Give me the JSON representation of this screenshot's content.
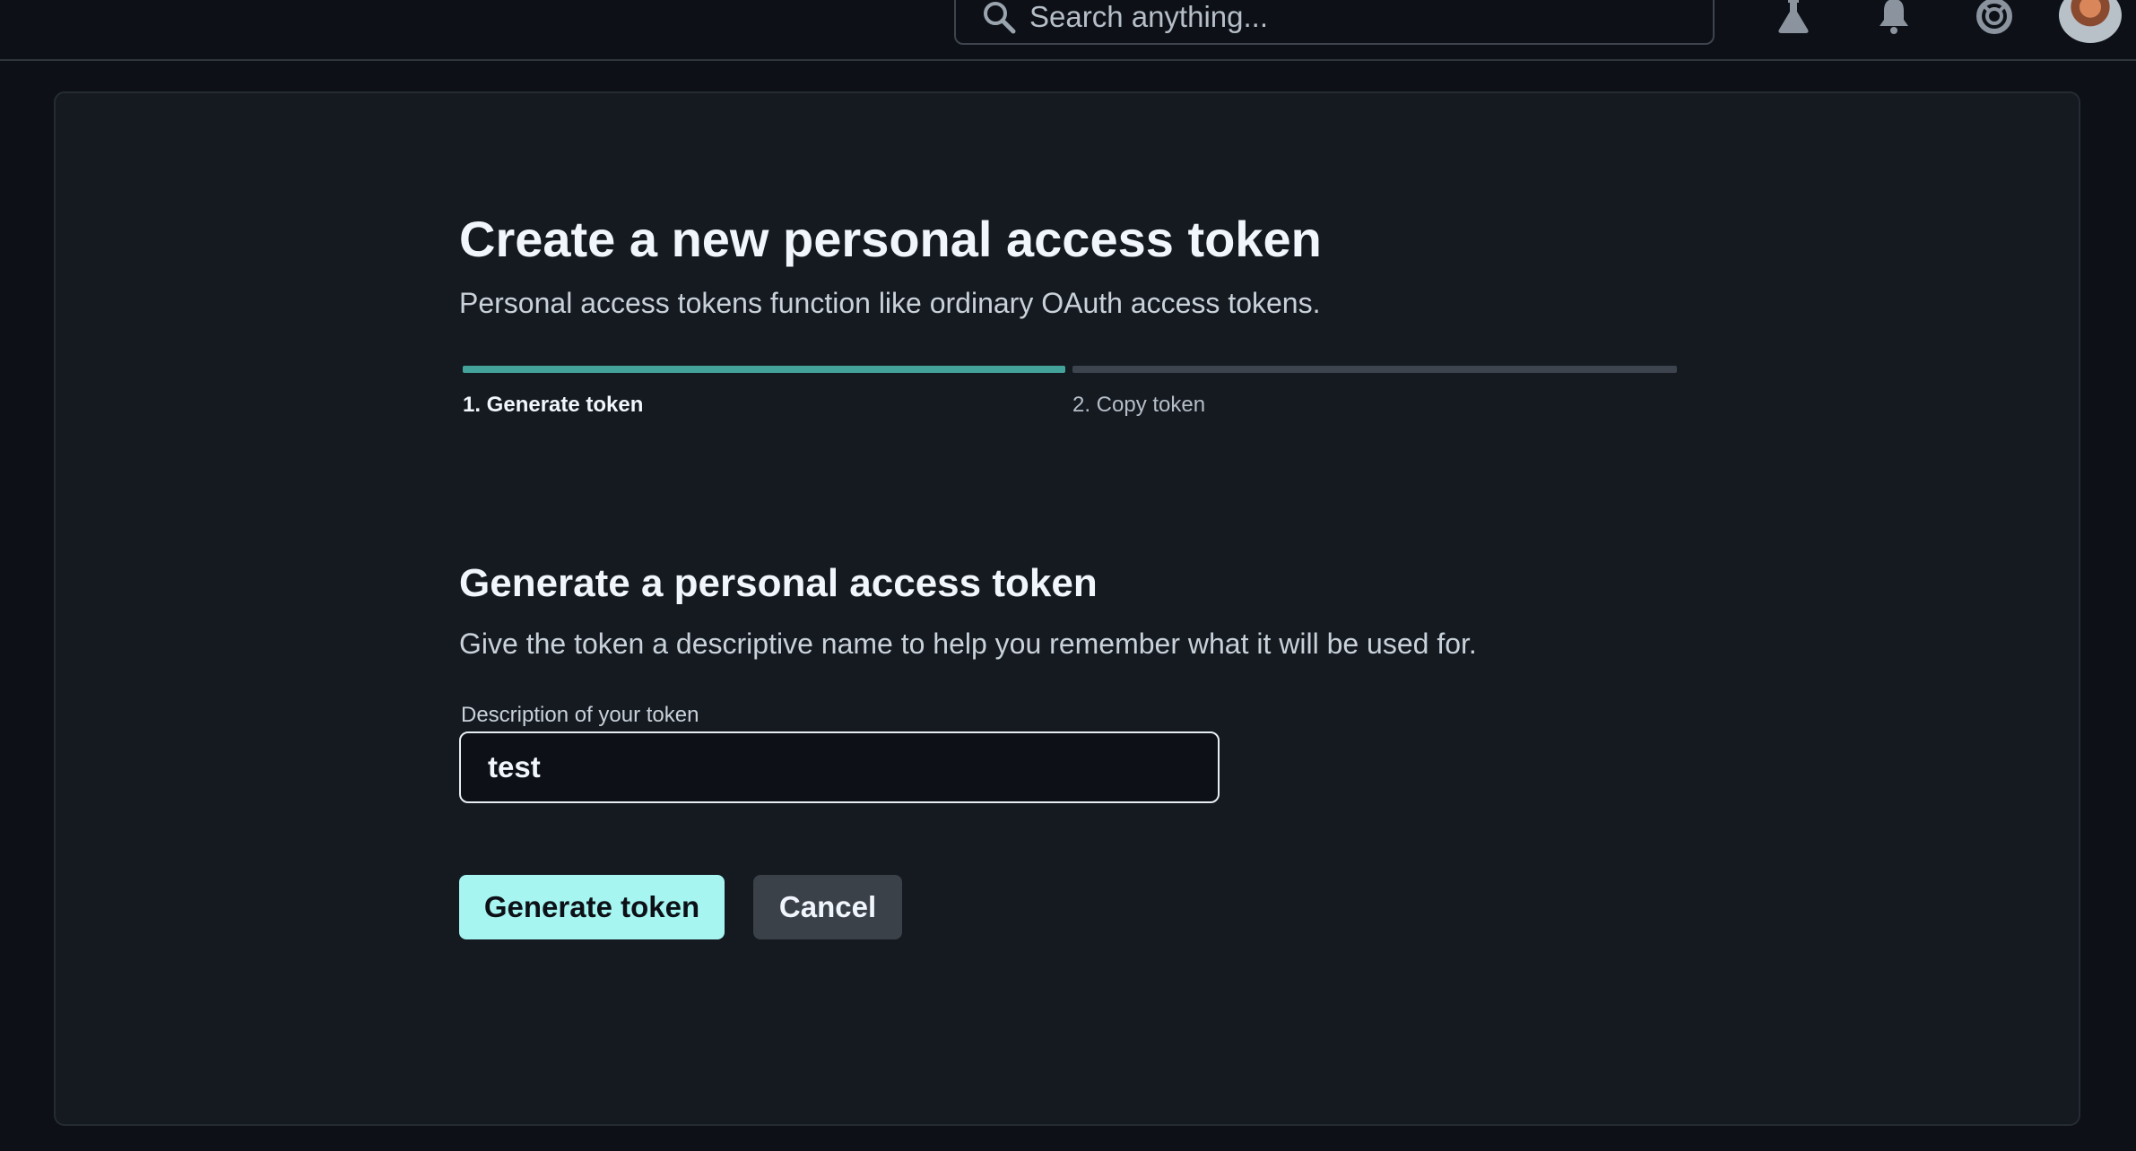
{
  "header": {
    "search_placeholder": "Search anything...",
    "icons": [
      "search-icon",
      "flask-icon",
      "bell-icon",
      "help-icon",
      "avatar"
    ]
  },
  "page": {
    "title": "Create a new personal access token",
    "subtitle": "Personal access tokens function like ordinary OAuth access tokens."
  },
  "stepper": {
    "steps": [
      {
        "label": "1. Generate token",
        "active": true
      },
      {
        "label": "2. Copy token",
        "active": false
      }
    ]
  },
  "form": {
    "heading": "Generate a personal access token",
    "description": "Give the token a descriptive name to help you remember what it will be used for.",
    "field_label": "Description of your token",
    "field_value": "test",
    "primary_button": "Generate token",
    "cancel_button": "Cancel"
  },
  "colors": {
    "background": "#0d1117",
    "card": "#151a21",
    "accent": "#43a39a",
    "primary_button": "#a6f5f0",
    "secondary_button": "#3b4148"
  }
}
